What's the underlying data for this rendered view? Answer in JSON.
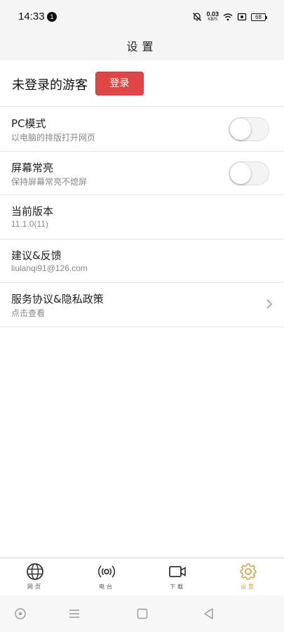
{
  "status_bar": {
    "time": "14:33",
    "notification_count": "1",
    "net_speed_value": "0.03",
    "net_speed_unit": "KB/S",
    "battery": "68"
  },
  "header": {
    "title": "设置"
  },
  "user": {
    "guest_label": "未登录的游客",
    "login_button": "登录"
  },
  "settings": [
    {
      "title": "PC模式",
      "subtitle": "以电脑的排版打开网页",
      "control": "toggle",
      "on": false
    },
    {
      "title": "屏幕常亮",
      "subtitle": "保持屏幕常亮不熄屏",
      "control": "toggle",
      "on": false
    },
    {
      "title": "当前版本",
      "subtitle": "11.1.0(11)"
    },
    {
      "title": "建议&反馈",
      "subtitle": "liulanqi91@126.com"
    },
    {
      "title": "服务协议&隐私政策",
      "subtitle": "点击查看",
      "control": "chevron"
    }
  ],
  "tabs": [
    {
      "label": "网页",
      "icon": "globe-icon",
      "active": false
    },
    {
      "label": "电台",
      "icon": "radio-icon",
      "active": false
    },
    {
      "label": "下载",
      "icon": "video-icon",
      "active": false
    },
    {
      "label": "设置",
      "icon": "gear-icon",
      "active": true
    }
  ],
  "colors": {
    "accent": "#d9a24a",
    "login_button": "#e04646"
  },
  "nav_bar": [
    "home-circle-icon",
    "menu-icon",
    "square-icon",
    "back-triangle-icon"
  ]
}
